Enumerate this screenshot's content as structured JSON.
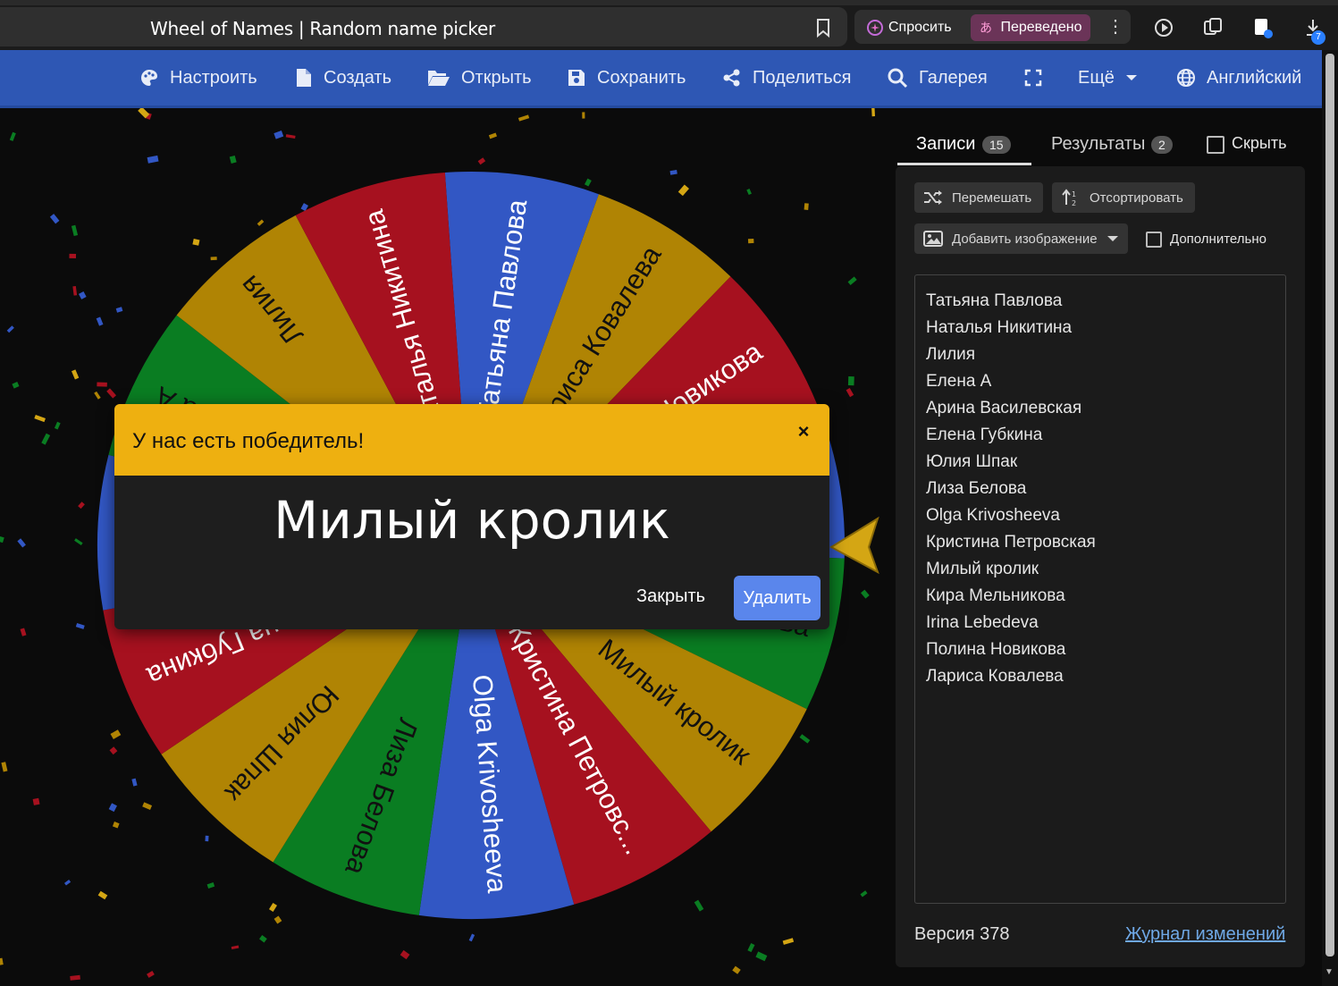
{
  "browser": {
    "tab_title": "Wheel of Names | Random name picker",
    "ask_label": "Спросить",
    "translated_label": "Переведено",
    "downloads_count": "7"
  },
  "nav": {
    "customize": "Настроить",
    "new": "Создать",
    "open": "Открыть",
    "save": "Сохранить",
    "share": "Поделиться",
    "gallery": "Галерея",
    "more": "Ещё",
    "language": "Английский"
  },
  "wheel": {
    "segments": [
      {
        "label": "Татьяна Павлова",
        "color": "#3257c4"
      },
      {
        "label": "Лариса Ковалева",
        "color": "#b08404"
      },
      {
        "label": "Полина Новикова",
        "color": "#a6111f"
      },
      {
        "label": "Irina Lebedeva",
        "color": "#3257c4"
      },
      {
        "label": "Кира Мельникова",
        "color": "#0a7d22"
      },
      {
        "label": "Милый кролик",
        "color": "#b08404"
      },
      {
        "label": "Кристина Петровская",
        "color": "#a6111f"
      },
      {
        "label": "Olga Krivosheeva",
        "color": "#3257c4"
      },
      {
        "label": "Лиза Белова",
        "color": "#0a7d22"
      },
      {
        "label": "Юлия Шпак",
        "color": "#b08404"
      },
      {
        "label": "Елена Губкина",
        "color": "#a6111f"
      },
      {
        "label": "Арина Василевская",
        "color": "#3257c4"
      },
      {
        "label": "Елена А",
        "color": "#0a7d22"
      },
      {
        "label": "Лилия",
        "color": "#b08404"
      },
      {
        "label": "Наталья Никитина",
        "color": "#a6111f"
      }
    ],
    "pointer_color": "#d4a614"
  },
  "dialog": {
    "title": "У нас есть победитель!",
    "close_symbol": "×",
    "winner": "Милый кролик",
    "close_label": "Закрыть",
    "remove_label": "Удалить",
    "header_color": "#eeb010"
  },
  "sidebar": {
    "entries_tab": "Записи",
    "entries_count": "15",
    "results_tab": "Результаты",
    "results_count": "2",
    "hide_label": "Скрыть",
    "shuffle_label": "Перемешать",
    "sort_label": "Отсортировать",
    "add_image_label": "Добавить изображение",
    "advanced_label": "Дополнительно",
    "entries": [
      "Татьяна Павлова",
      "Наталья Никитина",
      "Лилия",
      "Елена А",
      "Арина Василевская",
      "Елена Губкина",
      "Юлия Шпак",
      "Лиза Белова",
      "Olga Krivosheeva",
      "Кристина Петровская",
      "Милый кролик",
      "Кира Мельникова",
      "Irina Lebedeva",
      "Полина Новикова",
      "Лариса Ковалева"
    ],
    "version": "Версия 378",
    "changelog": "Журнал изменений"
  }
}
